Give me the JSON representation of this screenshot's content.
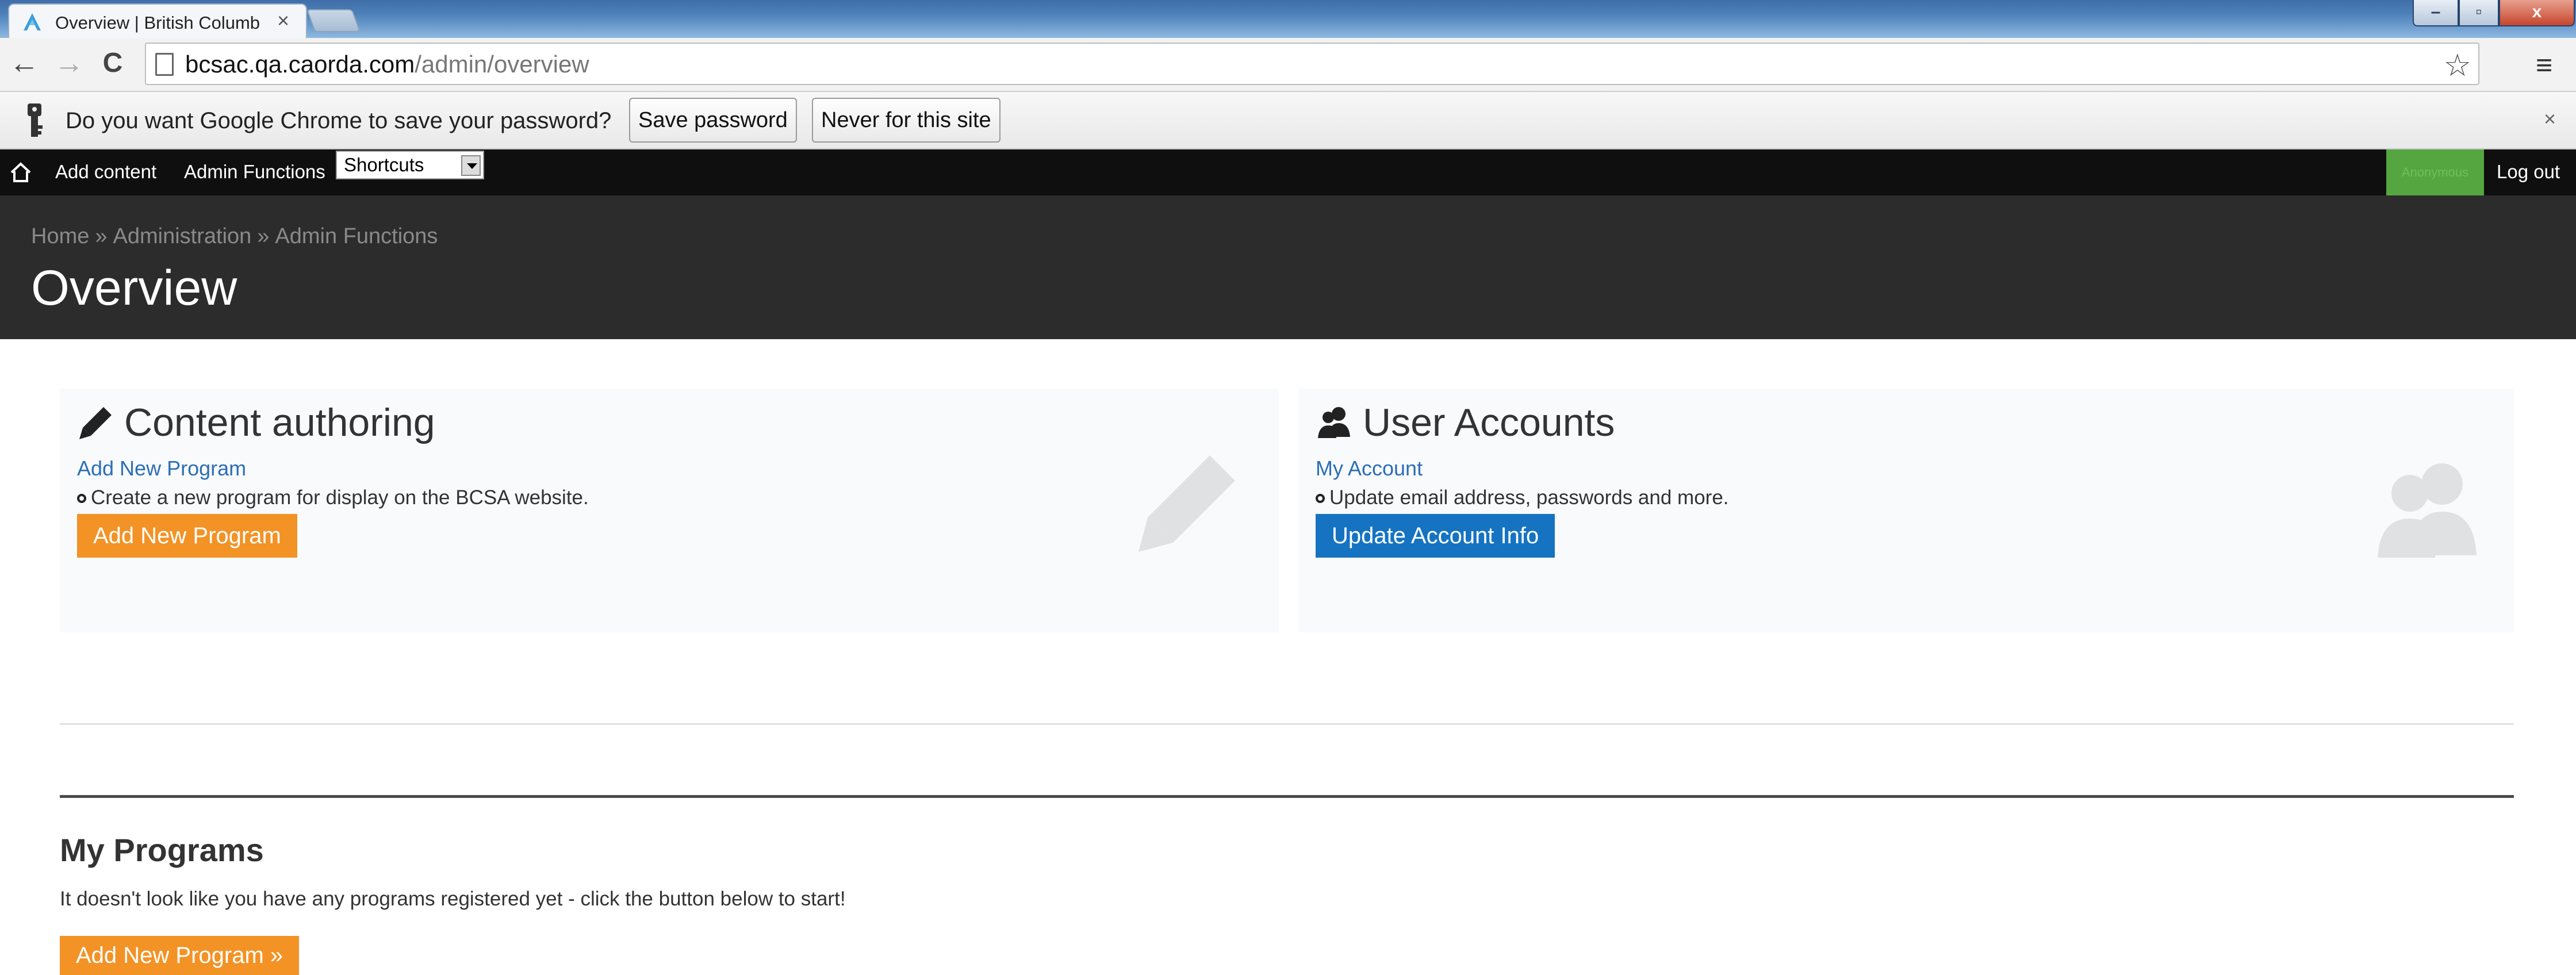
{
  "browser": {
    "tab_title": "Overview | British Columb",
    "tab_close": "×",
    "url_host": "bcsac.qa.caorda.com",
    "url_path": "/admin/overview",
    "back_glyph": "←",
    "forward_glyph": "→",
    "reload_glyph": "C",
    "star_glyph": "☆",
    "menu_glyph": "≡",
    "window_min": "–",
    "window_max": "▫",
    "window_close": "x"
  },
  "infobar": {
    "message": "Do you want Google Chrome to save your password?",
    "save_label": "Save password",
    "never_label": "Never for this site",
    "close_glyph": "×"
  },
  "admin_bar": {
    "add_content": "Add content",
    "admin_functions": "Admin Functions",
    "shortcuts": "Shortcuts",
    "username": "Anonymous",
    "logout": "Log out"
  },
  "header": {
    "breadcrumb": [
      "Home",
      "Administration",
      "Admin Functions"
    ],
    "separator": "»",
    "title": "Overview"
  },
  "panels": [
    {
      "title": "Content authoring",
      "link": "Add New Program",
      "description": "Create a new program for display on the BCSA website.",
      "button": "Add New Program",
      "icon": "pencil-icon"
    },
    {
      "title": "User Accounts",
      "link": "My Account",
      "description": "Update email address, passwords and more.",
      "button": "Update Account Info",
      "icon": "users-icon"
    }
  ],
  "programs": {
    "title": "My Programs",
    "empty_text": "It doesn't look like you have any programs registered yet - click the button below to start!",
    "button": "Add New Program »"
  },
  "colors": {
    "orange_button": "#f39225",
    "blue_button": "#1573c2",
    "header_bg": "#2c2c2c",
    "admin_bar_bg": "#0f0f0f",
    "user_badge": "#55a541"
  }
}
